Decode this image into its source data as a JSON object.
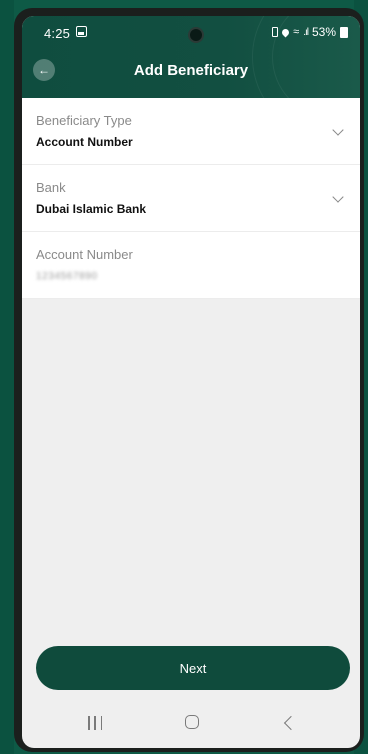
{
  "status_bar": {
    "time": "4:25",
    "battery_percent": "53%"
  },
  "header": {
    "title": "Add Beneficiary"
  },
  "form": {
    "fields": [
      {
        "label": "Beneficiary Type",
        "value": "Account Number",
        "has_dropdown": true
      },
      {
        "label": "Bank",
        "value": "Dubai Islamic Bank",
        "has_dropdown": true
      },
      {
        "label": "Account Number",
        "value": "1234567890",
        "has_dropdown": false
      }
    ]
  },
  "actions": {
    "next_label": "Next"
  },
  "colors": {
    "primary": "#0f4b3c",
    "header": "#124f41",
    "background": "#efefef"
  },
  "icons": {
    "back": "arrow-left-icon",
    "dropdown": "chevron-down-icon",
    "nav_recent": "recent-apps-icon",
    "nav_home": "home-icon",
    "nav_back": "nav-back-icon"
  }
}
